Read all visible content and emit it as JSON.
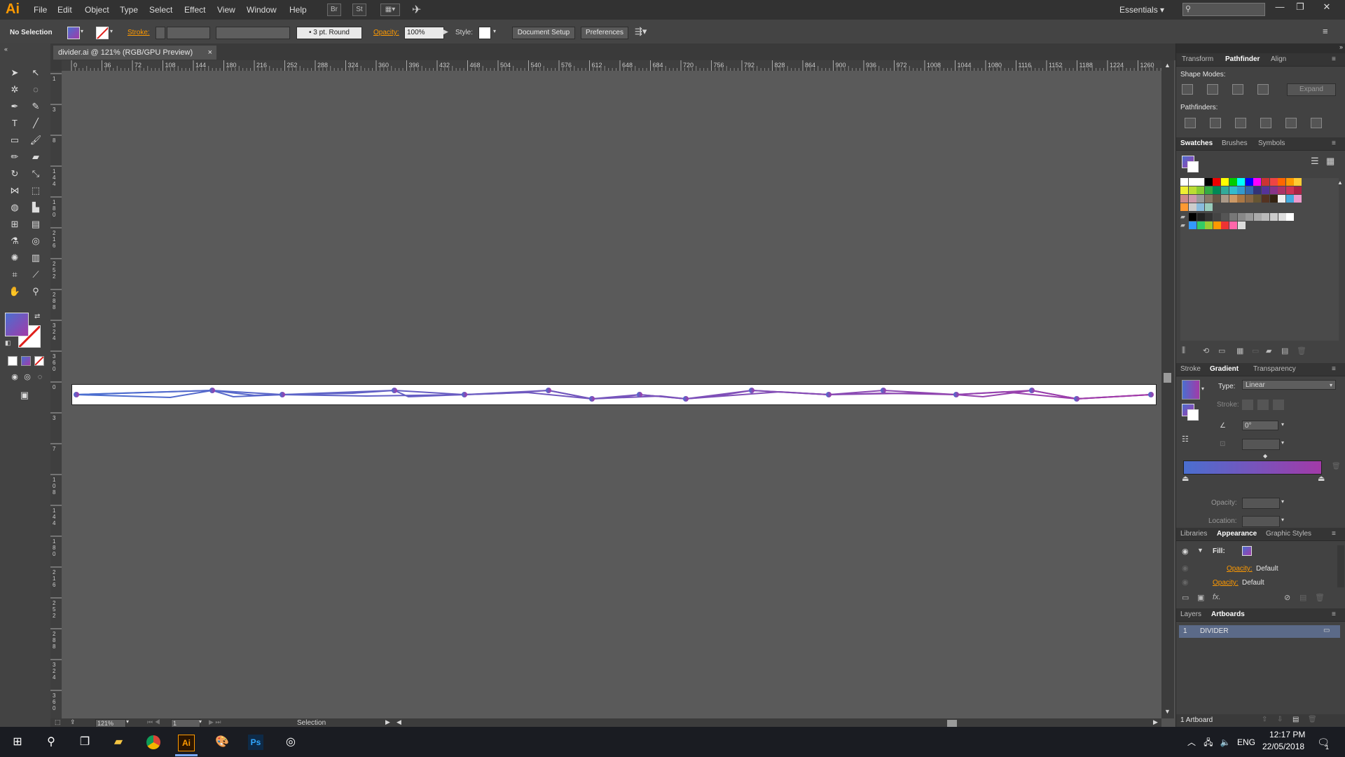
{
  "app": {
    "logo": "Ai"
  },
  "menu": [
    "File",
    "Edit",
    "Object",
    "Type",
    "Select",
    "Effect",
    "View",
    "Window",
    "Help"
  ],
  "menu_icons": {
    "bridge": "Br",
    "stock": "St",
    "layout": "arrange-icon",
    "sync": "sync-icon"
  },
  "workspace": "Essentials",
  "control_bar": {
    "selection": "No Selection",
    "stroke_label": "Stroke:",
    "brush": "3 pt. Round",
    "opacity_label": "Opacity:",
    "opacity_value": "100%",
    "style_label": "Style:",
    "doc_setup": "Document Setup",
    "preferences": "Preferences"
  },
  "document": {
    "tab_title": "divider.ai @ 121% (RGB/GPU Preview)",
    "close": "×",
    "ruler_ticks": [
      "0",
      "36",
      "72",
      "108",
      "144",
      "180",
      "216",
      "252",
      "288",
      "324",
      "360",
      "396",
      "432",
      "468",
      "504",
      "540",
      "576",
      "612",
      "648",
      "684",
      "720",
      "756",
      "792",
      "828",
      "864",
      "900",
      "936",
      "972",
      "1008",
      "1044",
      "1080",
      "1116",
      "1152",
      "1188",
      "1224",
      "1260"
    ],
    "vruler_ticks": [
      "1",
      "3",
      "8",
      "1 4 4",
      "1 8 0",
      "2 1 6",
      "2 5 2",
      "2 8 8",
      "3 2 4",
      "3 6 0",
      "0",
      "3",
      "7",
      "1 0 8",
      "1 4 4",
      "1 8 0",
      "2 1 6",
      "2 5 2",
      "2 8 8",
      "3 2 4",
      "3 6 0"
    ]
  },
  "status": {
    "zoom": "121%",
    "page": "1",
    "tool": "Selection"
  },
  "panels": {
    "top_tabs": [
      "Transform",
      "Pathfinder",
      "Align"
    ],
    "shape_modes": "Shape Modes:",
    "expand": "Expand",
    "pathfinders": "Pathfinders:",
    "swatch_tabs": [
      "Swatches",
      "Brushes",
      "Symbols"
    ],
    "gradient_tabs": [
      "Stroke",
      "Gradient",
      "Transparency"
    ],
    "gradient": {
      "type_label": "Type:",
      "type_value": "Linear",
      "stroke_label": "Stroke:",
      "angle": "0°",
      "opacity_label": "Opacity:",
      "location_label": "Location:",
      "start_color": "#4a6fd0",
      "end_color": "#a23aa8"
    },
    "appearance_tabs": [
      "Libraries",
      "Appearance",
      "Graphic Styles"
    ],
    "appearance": {
      "fill_label": "Fill:",
      "opacity_row1_label": "Opacity:",
      "opacity_row1_value": "Default",
      "opacity_row2_label": "Opacity:",
      "opacity_row2_value": "Default"
    },
    "layers_tabs": [
      "Layers",
      "Artboards"
    ],
    "artboards": [
      {
        "num": "1",
        "name": "DIVIDER"
      }
    ],
    "artboard_count": "1 Artboard"
  },
  "taskbar": {
    "lang": "ENG",
    "time": "12:17 PM",
    "date": "22/05/2018",
    "notifications": "1"
  },
  "colors": {
    "accent_orange": "#ff9a00",
    "line_blue": "#4a6fd0",
    "line_purple": "#a23aa8"
  }
}
